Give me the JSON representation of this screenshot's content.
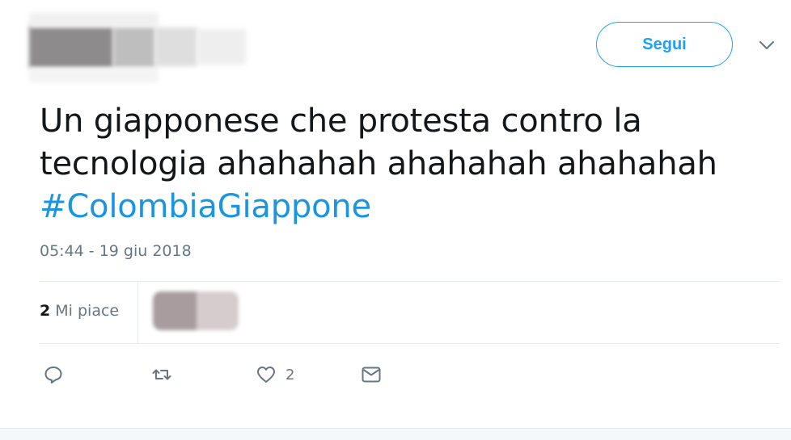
{
  "header": {
    "follow_label": "Segui"
  },
  "tweet": {
    "text_line1": "Un giapponese che protesta contro la",
    "text_line2": "tecnologia ahahahah ahahahah ahahahah",
    "hashtag": "#ColombiaGiappone",
    "timestamp": "05:44 - 19 giu 2018"
  },
  "stats": {
    "likes_count": "2",
    "likes_label": "Mi piace"
  },
  "actions": {
    "like_count": "2"
  },
  "colors": {
    "accent": "#1da1f2",
    "hashtag": "#1b95e0",
    "text": "#14171a",
    "muted": "#657786",
    "divider": "#e6ecf0"
  },
  "icons": [
    "chevron-down-icon",
    "reply-icon",
    "retweet-icon",
    "heart-icon",
    "mail-icon"
  ]
}
